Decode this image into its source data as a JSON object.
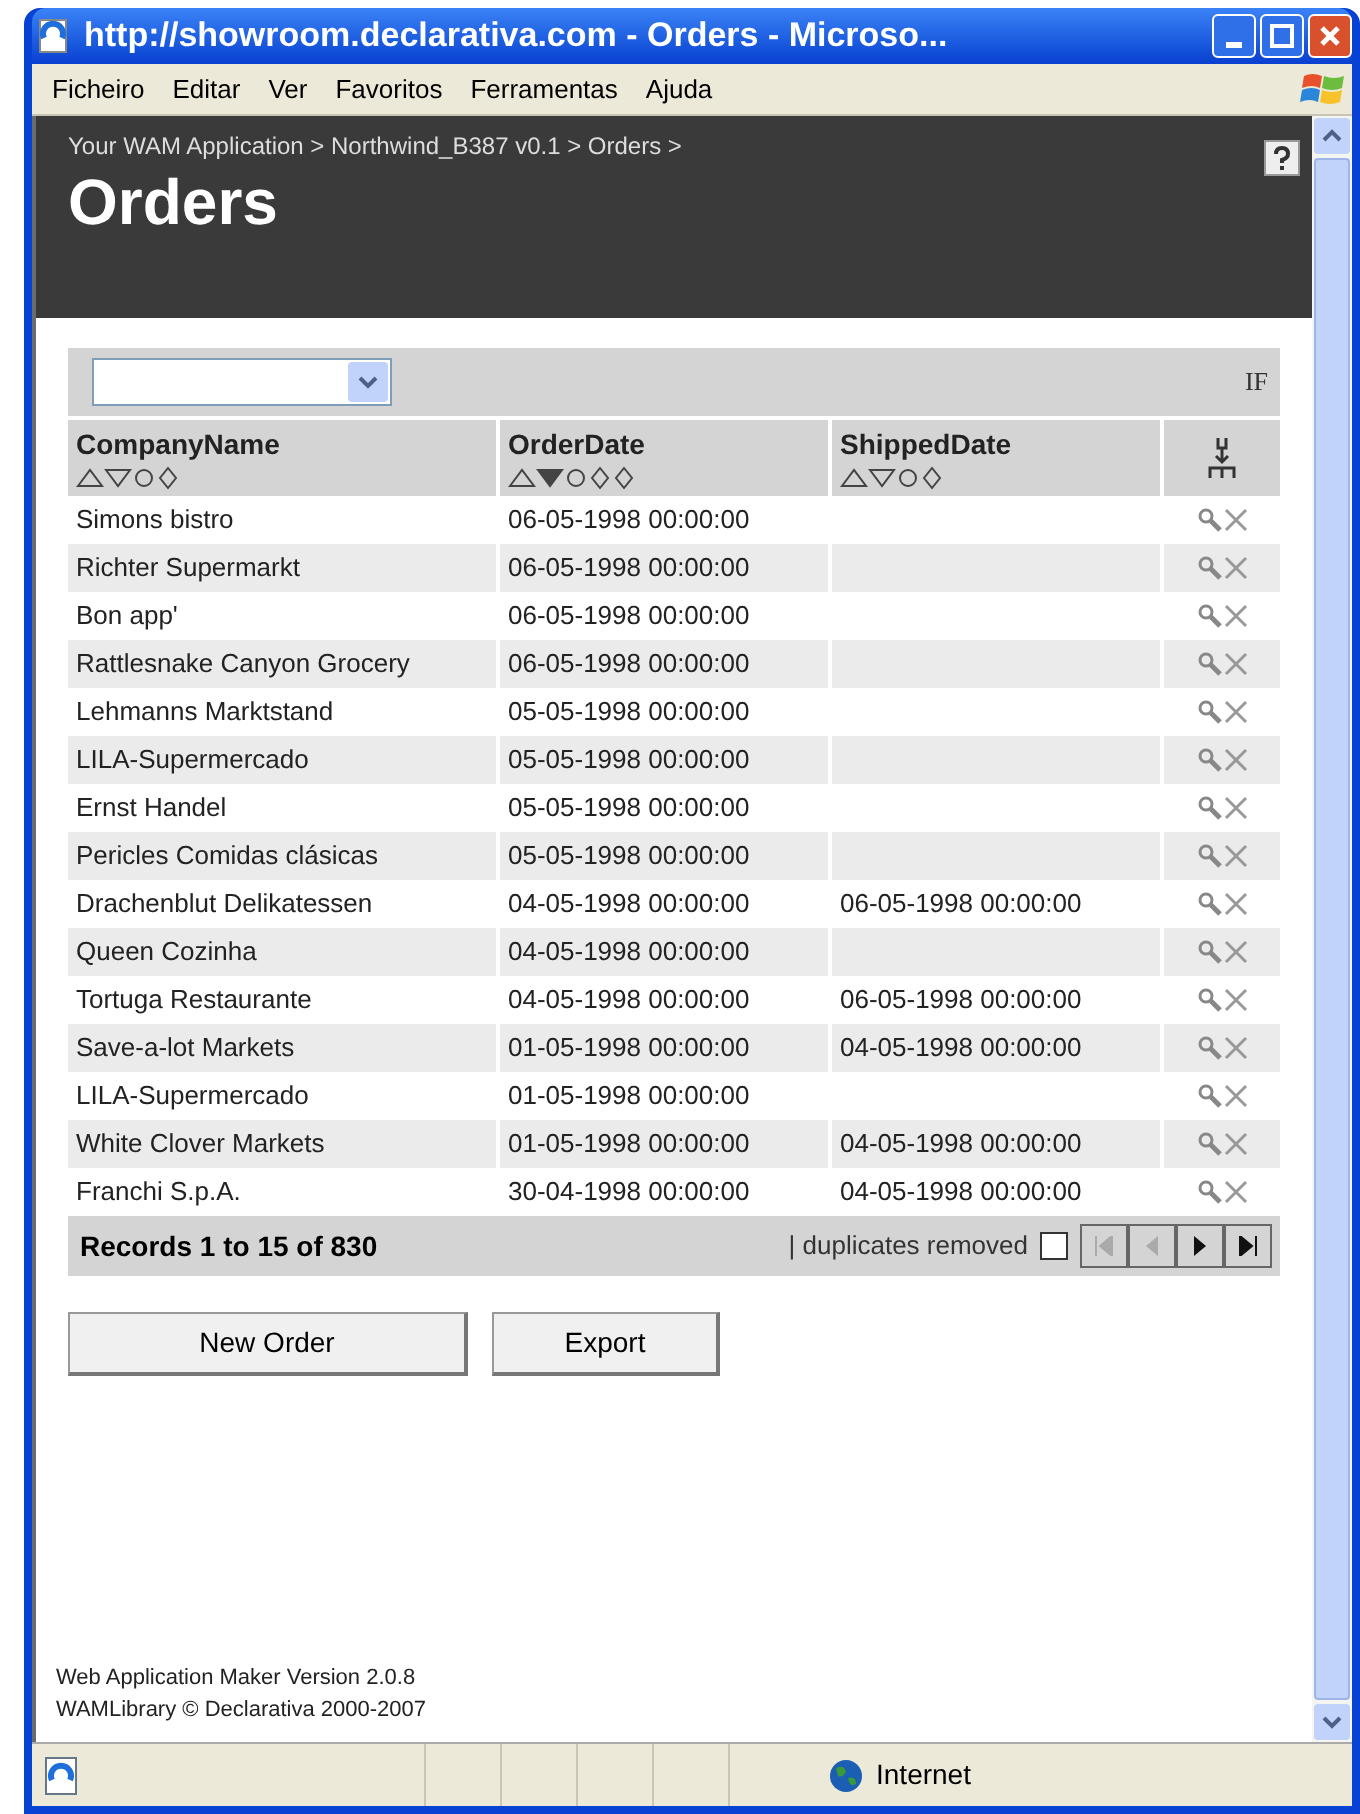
{
  "window": {
    "title": "http://showroom.declarativa.com - Orders - Microso..."
  },
  "menu": [
    "Ficheiro",
    "Editar",
    "Ver",
    "Favoritos",
    "Ferramentas",
    "Ajuda"
  ],
  "breadcrumb": "Your WAM Application > Northwind_B387 v0.1 > Orders >",
  "page_title": "Orders",
  "filter": {
    "label": "IF"
  },
  "table": {
    "columns": [
      {
        "label": "CompanyName",
        "sorted_descending": false
      },
      {
        "label": "OrderDate",
        "sorted_descending": true
      },
      {
        "label": "ShippedDate",
        "sorted_descending": false
      }
    ],
    "rows": [
      [
        "Simons bistro",
        "06-05-1998 00:00:00",
        ""
      ],
      [
        "Richter Supermarkt",
        "06-05-1998 00:00:00",
        ""
      ],
      [
        "Bon app'",
        "06-05-1998 00:00:00",
        ""
      ],
      [
        "Rattlesnake Canyon Grocery",
        "06-05-1998 00:00:00",
        ""
      ],
      [
        "Lehmanns Marktstand",
        "05-05-1998 00:00:00",
        ""
      ],
      [
        "LILA-Supermercado",
        "05-05-1998 00:00:00",
        ""
      ],
      [
        "Ernst Handel",
        "05-05-1998 00:00:00",
        ""
      ],
      [
        "Pericles Comidas clásicas",
        "05-05-1998 00:00:00",
        ""
      ],
      [
        "Drachenblut Delikatessen",
        "04-05-1998 00:00:00",
        "06-05-1998 00:00:00"
      ],
      [
        "Queen Cozinha",
        "04-05-1998 00:00:00",
        ""
      ],
      [
        "Tortuga Restaurante",
        "04-05-1998 00:00:00",
        "06-05-1998 00:00:00"
      ],
      [
        "Save-a-lot Markets",
        "01-05-1998 00:00:00",
        "04-05-1998 00:00:00"
      ],
      [
        "LILA-Supermercado",
        "01-05-1998 00:00:00",
        ""
      ],
      [
        "White Clover Markets",
        "01-05-1998 00:00:00",
        "04-05-1998 00:00:00"
      ],
      [
        "Franchi S.p.A.",
        "30-04-1998 00:00:00",
        "04-05-1998 00:00:00"
      ]
    ],
    "records": "Records 1 to 15 of 830",
    "duplicates": {
      "label": "| duplicates removed",
      "checked": false
    }
  },
  "buttons": [
    "New Order",
    "Export"
  ],
  "footer": [
    "Web Application Maker Version 2.0.8",
    "WAMLibrary © Declarativa 2000-2007"
  ],
  "status_bar": {
    "zone": "Internet"
  }
}
